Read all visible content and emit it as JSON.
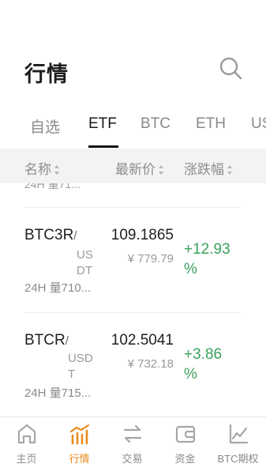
{
  "header": {
    "title": "行情"
  },
  "tabs": [
    {
      "label": "自选"
    },
    {
      "label": "ETF"
    },
    {
      "label": "BTC"
    },
    {
      "label": "ETH"
    },
    {
      "label": "US"
    }
  ],
  "columns": {
    "name": "名称",
    "price": "最新价",
    "change": "涨跌幅"
  },
  "partial_row_text": "24H 量71...",
  "rows": [
    {
      "symbol": "BTC3R",
      "quote": "USDT",
      "price": "109.1865",
      "price_cny": "¥ 779.79",
      "volume": "24H 量710...",
      "change": "+12.93 %"
    },
    {
      "symbol": "BTCR",
      "quote": "USDT",
      "price": "102.5041",
      "price_cny": "¥ 732.18",
      "volume": "24H 量715...",
      "change": "+3.86 %"
    }
  ],
  "bottom_nav": [
    {
      "label": "主页",
      "icon": "home-icon"
    },
    {
      "label": "行情",
      "icon": "market-chart-icon",
      "active": true
    },
    {
      "label": "交易",
      "icon": "trade-arrows-icon"
    },
    {
      "label": "资金",
      "icon": "wallet-icon"
    },
    {
      "label": "BTC期权",
      "icon": "options-chart-icon"
    }
  ],
  "colors": {
    "accent": "#e88a1a",
    "up": "#3aa05c",
    "text": "#1f1f1f",
    "muted": "#8d8d8d"
  }
}
